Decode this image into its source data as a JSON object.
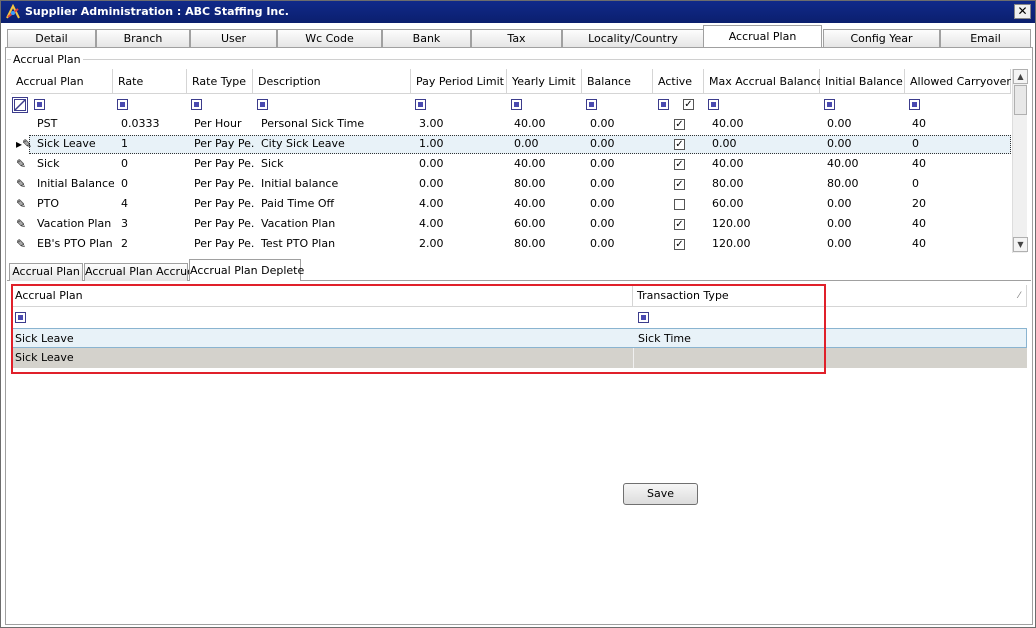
{
  "window": {
    "title": "Supplier Administration : ABC Staffing Inc.",
    "close_glyph": "✕"
  },
  "main_tabs": [
    {
      "label": "Detail"
    },
    {
      "label": "Branch"
    },
    {
      "label": "User"
    },
    {
      "label": "Wc Code"
    },
    {
      "label": "Bank"
    },
    {
      "label": "Tax"
    },
    {
      "label": "Locality/Country"
    },
    {
      "label": "Accrual Plan"
    },
    {
      "label": "Config Year"
    },
    {
      "label": "Email"
    }
  ],
  "group_title": "Accrual Plan",
  "upper_grid": {
    "columns": [
      "Accrual Plan",
      "Rate",
      "Rate Type",
      "Description",
      "Pay Period Limit",
      "Yearly Limit",
      "Balance",
      "Active",
      "Max Accrual Balance",
      "Initial Balance",
      "Allowed Carryover"
    ],
    "rows": [
      {
        "plan": "PST",
        "rate": "0.0333",
        "rate_type": "Per Hour",
        "desc": "Personal Sick Time",
        "ppl": "3.00",
        "yl": "40.00",
        "bal": "0.00",
        "active": true,
        "max": "40.00",
        "init": "0.00",
        "carry": "40"
      },
      {
        "plan": "Sick Leave",
        "rate": "1",
        "rate_type": "Per Pay Pe...",
        "desc": "City Sick Leave",
        "ppl": "1.00",
        "yl": "0.00",
        "bal": "0.00",
        "active": true,
        "max": "0.00",
        "init": "0.00",
        "carry": "0"
      },
      {
        "plan": "Sick",
        "rate": "0",
        "rate_type": "Per Pay Pe...",
        "desc": "Sick",
        "ppl": "0.00",
        "yl": "40.00",
        "bal": "0.00",
        "active": true,
        "max": "40.00",
        "init": "40.00",
        "carry": "40"
      },
      {
        "plan": "Initial Balance",
        "rate": "0",
        "rate_type": "Per Pay Pe...",
        "desc": "Initial balance",
        "ppl": "0.00",
        "yl": "80.00",
        "bal": "0.00",
        "active": true,
        "max": "80.00",
        "init": "80.00",
        "carry": "0"
      },
      {
        "plan": "PTO",
        "rate": "4",
        "rate_type": "Per Pay Pe...",
        "desc": "Paid Time Off",
        "ppl": "4.00",
        "yl": "40.00",
        "bal": "0.00",
        "active": false,
        "max": "60.00",
        "init": "0.00",
        "carry": "20"
      },
      {
        "plan": "Vacation Plan",
        "rate": "3",
        "rate_type": "Per Pay Pe...",
        "desc": "Vacation Plan",
        "ppl": "4.00",
        "yl": "60.00",
        "bal": "0.00",
        "active": true,
        "max": "120.00",
        "init": "0.00",
        "carry": "40"
      },
      {
        "plan": "EB's PTO Plan",
        "rate": "2",
        "rate_type": "Per Pay Pe...",
        "desc": "Test PTO Plan",
        "ppl": "2.00",
        "yl": "80.00",
        "bal": "0.00",
        "active": true,
        "max": "120.00",
        "init": "0.00",
        "carry": "40"
      }
    ]
  },
  "sub_tabs": [
    {
      "label": "Accrual  Plan"
    },
    {
      "label": "Accrual Plan Accrue"
    },
    {
      "label": "Accrual Plan Deplete"
    }
  ],
  "lower_grid": {
    "columns": [
      "Accrual Plan",
      "Transaction Type"
    ],
    "rows": [
      {
        "plan": "Sick Leave",
        "type": "Sick Time"
      },
      {
        "plan": "Sick Leave",
        "type": ""
      }
    ]
  },
  "save_label": "Save",
  "colors": {
    "title_bar": "#0b1f6e",
    "highlight": "#e0202a"
  }
}
